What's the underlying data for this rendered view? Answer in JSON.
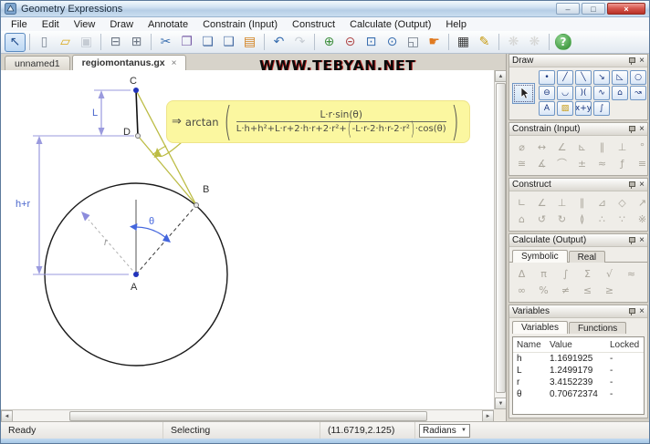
{
  "window": {
    "title": "Geometry Expressions",
    "controls": {
      "minimize": "–",
      "maximize": "□",
      "close": "×"
    }
  },
  "watermark": "WWW.TEBYAN.NET",
  "menu": {
    "items": [
      "File",
      "Edit",
      "View",
      "Draw",
      "Annotate",
      "Constrain (Input)",
      "Construct",
      "Calculate (Output)",
      "Help"
    ]
  },
  "toolbar": {
    "items": [
      {
        "name": "select-tool-button",
        "glyph": "↖",
        "color": "#23508f",
        "active": true
      },
      {
        "type": "sep"
      },
      {
        "name": "new-document-button",
        "glyph": "▯",
        "color": "#7d8794"
      },
      {
        "name": "open-file-button",
        "glyph": "▱",
        "color": "#d9a715"
      },
      {
        "name": "save-button",
        "glyph": "▣",
        "color": "#8a93a0",
        "disabled": true
      },
      {
        "type": "sep"
      },
      {
        "name": "print-button",
        "glyph": "⊟",
        "color": "#6d7784"
      },
      {
        "name": "print-preview-button",
        "glyph": "⊞",
        "color": "#6d7784"
      },
      {
        "type": "sep"
      },
      {
        "name": "cut-button",
        "glyph": "✂",
        "color": "#3a6fb0"
      },
      {
        "name": "copy-button",
        "glyph": "❐",
        "color": "#7a5fa8"
      },
      {
        "name": "paste-button",
        "glyph": "❏",
        "color": "#4a6fa5"
      },
      {
        "name": "paste-special-button",
        "glyph": "❑",
        "color": "#4a6fa5"
      },
      {
        "name": "clipboard-button",
        "glyph": "▤",
        "color": "#d2801e"
      },
      {
        "type": "sep"
      },
      {
        "name": "undo-button",
        "glyph": "↶",
        "color": "#3a6fb0"
      },
      {
        "name": "redo-button",
        "glyph": "↷",
        "color": "#8a93a0",
        "disabled": true
      },
      {
        "type": "sep"
      },
      {
        "name": "zoom-in-button",
        "glyph": "⊕",
        "color": "#3f8f3f"
      },
      {
        "name": "zoom-out-button",
        "glyph": "⊝",
        "color": "#b04848"
      },
      {
        "name": "zoom-window-button",
        "glyph": "⊡",
        "color": "#3a6fb0"
      },
      {
        "name": "zoom-selection-button",
        "glyph": "⊙",
        "color": "#3a6fb0"
      },
      {
        "name": "zoom-page-button",
        "glyph": "◱",
        "color": "#6d7784"
      },
      {
        "name": "pan-button",
        "glyph": "☛",
        "color": "#e07a20"
      },
      {
        "type": "sep"
      },
      {
        "name": "grid-button",
        "glyph": "▦",
        "color": "#3a3a3a"
      },
      {
        "name": "sketch-mode-button",
        "glyph": "✎",
        "color": "#c79a10"
      },
      {
        "type": "sep"
      },
      {
        "name": "animate-button",
        "glyph": "❋",
        "color": "#b0aba2",
        "disabled": true
      },
      {
        "name": "drag-mode-button",
        "glyph": "❋",
        "color": "#b0aba2",
        "disabled": true
      },
      {
        "type": "sep"
      },
      {
        "name": "help-button",
        "glyph": "?",
        "color": "#ffffff",
        "cls": "help"
      }
    ]
  },
  "tabs": [
    {
      "label": "unnamed1"
    },
    {
      "label": "regiomontanus.gx",
      "close_glyph": "×"
    }
  ],
  "geometry": {
    "labels": {
      "A": "A",
      "B": "B",
      "C": "C",
      "D": "D",
      "L": "L",
      "h_plus_r": "h+r",
      "r": "r",
      "theta": "θ"
    }
  },
  "formula": {
    "arrow": "⇒",
    "func": "arctan",
    "paren_open": "(",
    "paren_close": ")",
    "numerator": "L·r·sin(θ)",
    "den_pre": "L·h+h²+L·r+2·h·r+2·r²+",
    "den_inner": "-L·r-2·h·r-2·r²",
    "den_post": "·cos(θ)"
  },
  "ui": {
    "close_glyph": "×",
    "scroll_up": "▲",
    "scroll_down": "▼",
    "scroll_left": "◄",
    "scroll_right": "►",
    "dropdown_arrow": "▼"
  },
  "panels": {
    "draw": {
      "title": "Draw",
      "tools": [
        {
          "name": "draw-point",
          "glyph": "•"
        },
        {
          "name": "draw-line-segment",
          "glyph": "╱"
        },
        {
          "name": "draw-infinite-line",
          "glyph": "╲"
        },
        {
          "name": "draw-vector",
          "glyph": "↘"
        },
        {
          "name": "draw-polygon",
          "glyph": "◺"
        },
        {
          "name": "draw-circle",
          "glyph": "○"
        },
        {
          "name": "draw-ellipse",
          "glyph": "⊖"
        },
        {
          "name": "draw-arc",
          "glyph": "◡"
        },
        {
          "name": "draw-conic",
          "glyph": ")("
        },
        {
          "name": "draw-curve",
          "glyph": "∿"
        },
        {
          "name": "draw-regular-polygon",
          "glyph": "⌂"
        },
        {
          "name": "draw-point-on-curve",
          "glyph": "↝"
        },
        {
          "name": "draw-text",
          "glyph": "A"
        },
        {
          "name": "draw-picture",
          "glyph": "▨",
          "color": "#c79a10"
        },
        {
          "name": "draw-expression",
          "glyph": "x+y"
        },
        {
          "name": "draw-function",
          "glyph": "∫"
        }
      ]
    },
    "constrain": {
      "title": "Constrain (Input)",
      "tools": [
        "⌀",
        "↔",
        "∠",
        "⊾",
        "∥",
        "⊥",
        "°",
        "≅",
        "∡",
        "⌒",
        "±",
        "≈",
        "ƒ",
        "≡"
      ]
    },
    "construct": {
      "title": "Construct",
      "tools": [
        "∟",
        "∠",
        "⊥",
        "∥",
        "⊿",
        "◇",
        "↗",
        "⌂",
        "↺",
        "↻",
        "≬",
        "∴",
        "∵",
        "※"
      ]
    },
    "calculate": {
      "title": "Calculate (Output)",
      "tabs": [
        "Symbolic",
        "Real"
      ],
      "tools": [
        "Δ",
        "π",
        "∫",
        "Σ",
        "√",
        "≈",
        "∞",
        "%",
        "≠",
        "≤",
        "≥"
      ]
    },
    "variables": {
      "title": "Variables",
      "tabs": [
        "Variables",
        "Functions"
      ],
      "columns": [
        "Name",
        "Value",
        "Locked"
      ],
      "rows": [
        {
          "name": "h",
          "value": "1.1691925",
          "locked": "-"
        },
        {
          "name": "L",
          "value": "1.2499179",
          "locked": "-"
        },
        {
          "name": "r",
          "value": "3.4152239",
          "locked": "-"
        },
        {
          "name": "θ",
          "value": "0.70672374",
          "locked": "-"
        }
      ]
    }
  },
  "statusbar": {
    "state": "Ready",
    "mode": "Selecting",
    "coordinates": "(11.6719,2.125)",
    "angle_mode": "Radians"
  }
}
